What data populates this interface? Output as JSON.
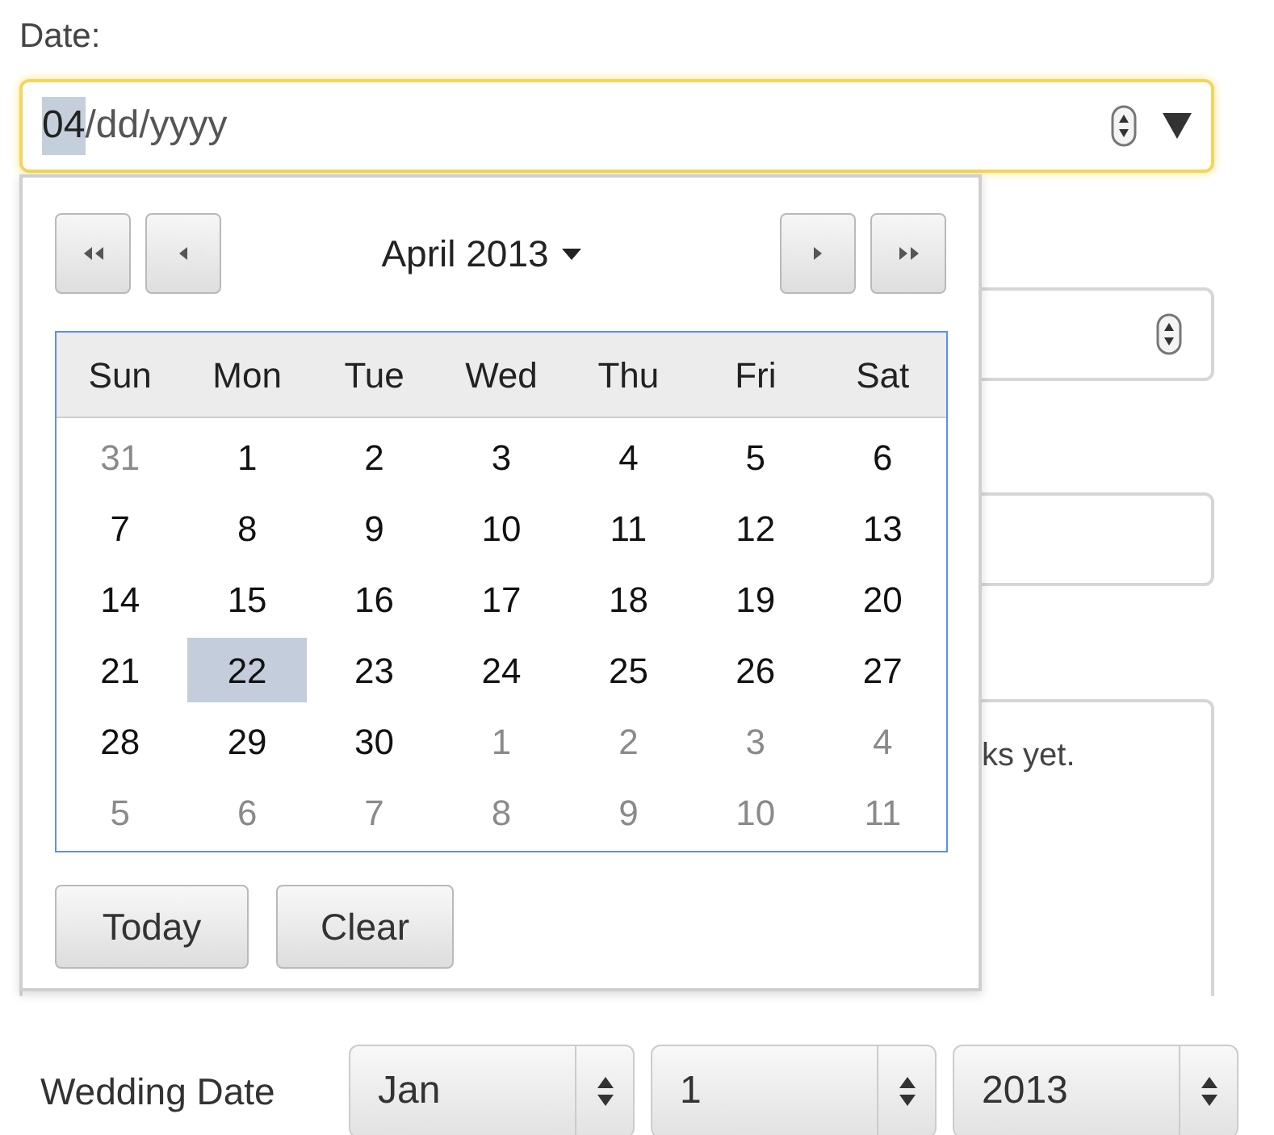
{
  "date_label": "Date:",
  "date_field": {
    "segments": [
      {
        "text": "04",
        "selected": true
      },
      {
        "text": "/dd/yyyy",
        "selected": false
      }
    ]
  },
  "textarea": {
    "visible_text": "ks yet."
  },
  "datepicker": {
    "title": "April 2013",
    "weekdays": [
      "Sun",
      "Mon",
      "Tue",
      "Wed",
      "Thu",
      "Fri",
      "Sat"
    ],
    "weeks": [
      [
        {
          "day": "31",
          "muted": true,
          "selected": false
        },
        {
          "day": "1",
          "muted": false,
          "selected": false
        },
        {
          "day": "2",
          "muted": false,
          "selected": false
        },
        {
          "day": "3",
          "muted": false,
          "selected": false
        },
        {
          "day": "4",
          "muted": false,
          "selected": false
        },
        {
          "day": "5",
          "muted": false,
          "selected": false
        },
        {
          "day": "6",
          "muted": false,
          "selected": false
        }
      ],
      [
        {
          "day": "7",
          "muted": false,
          "selected": false
        },
        {
          "day": "8",
          "muted": false,
          "selected": false
        },
        {
          "day": "9",
          "muted": false,
          "selected": false
        },
        {
          "day": "10",
          "muted": false,
          "selected": false
        },
        {
          "day": "11",
          "muted": false,
          "selected": false
        },
        {
          "day": "12",
          "muted": false,
          "selected": false
        },
        {
          "day": "13",
          "muted": false,
          "selected": false
        }
      ],
      [
        {
          "day": "14",
          "muted": false,
          "selected": false
        },
        {
          "day": "15",
          "muted": false,
          "selected": false
        },
        {
          "day": "16",
          "muted": false,
          "selected": false
        },
        {
          "day": "17",
          "muted": false,
          "selected": false
        },
        {
          "day": "18",
          "muted": false,
          "selected": false
        },
        {
          "day": "19",
          "muted": false,
          "selected": false
        },
        {
          "day": "20",
          "muted": false,
          "selected": false
        }
      ],
      [
        {
          "day": "21",
          "muted": false,
          "selected": false
        },
        {
          "day": "22",
          "muted": false,
          "selected": true
        },
        {
          "day": "23",
          "muted": false,
          "selected": false
        },
        {
          "day": "24",
          "muted": false,
          "selected": false
        },
        {
          "day": "25",
          "muted": false,
          "selected": false
        },
        {
          "day": "26",
          "muted": false,
          "selected": false
        },
        {
          "day": "27",
          "muted": false,
          "selected": false
        }
      ],
      [
        {
          "day": "28",
          "muted": false,
          "selected": false
        },
        {
          "day": "29",
          "muted": false,
          "selected": false
        },
        {
          "day": "30",
          "muted": false,
          "selected": false
        },
        {
          "day": "1",
          "muted": true,
          "selected": false
        },
        {
          "day": "2",
          "muted": true,
          "selected": false
        },
        {
          "day": "3",
          "muted": true,
          "selected": false
        },
        {
          "day": "4",
          "muted": true,
          "selected": false
        }
      ],
      [
        {
          "day": "5",
          "muted": true,
          "selected": false
        },
        {
          "day": "6",
          "muted": true,
          "selected": false
        },
        {
          "day": "7",
          "muted": true,
          "selected": false
        },
        {
          "day": "8",
          "muted": true,
          "selected": false
        },
        {
          "day": "9",
          "muted": true,
          "selected": false
        },
        {
          "day": "10",
          "muted": true,
          "selected": false
        },
        {
          "day": "11",
          "muted": true,
          "selected": false
        }
      ]
    ],
    "buttons": [
      "Today",
      "Clear"
    ]
  },
  "wedding_date": {
    "label": "Wedding Date",
    "selects": [
      "Jan",
      "1",
      "2013"
    ]
  }
}
